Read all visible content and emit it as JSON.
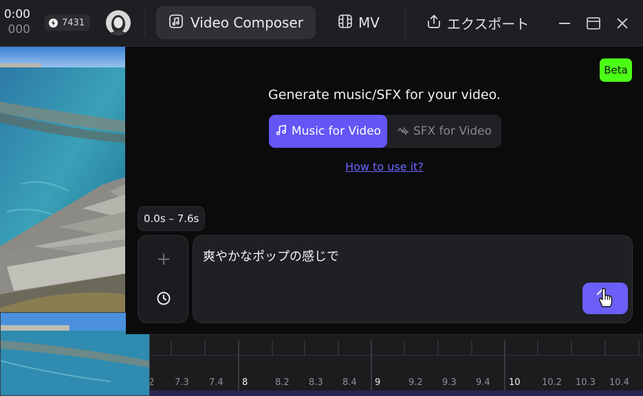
{
  "topbar": {
    "time_current": "0:00",
    "time_sub": "000",
    "credits": "7431",
    "tabs": [
      {
        "label": "Video Composer",
        "active": true
      },
      {
        "label": "MV",
        "active": false
      },
      {
        "label": "エクスポート",
        "active": false
      }
    ]
  },
  "panel": {
    "beta_badge": "Beta",
    "headline": "Generate music/SFX for your video.",
    "segments": [
      {
        "label": "Music for Video",
        "active": true
      },
      {
        "label": "SFX for Video",
        "active": false
      }
    ],
    "howto_link": "How to use it?",
    "range_badge": "0.0s – 7.6s",
    "prompt_value": "爽やかなポップの感じで"
  },
  "timeline": {
    "labels": [
      "2",
      "7.3",
      "7.4",
      "8",
      "8.2",
      "8.3",
      "8.4",
      "9",
      "9.2",
      "9.3",
      "9.4",
      "10",
      "10.2",
      "10.3",
      "10.4"
    ]
  },
  "colors": {
    "accent": "#6356f5",
    "beta": "#4cff17",
    "link": "#6f66ff"
  }
}
